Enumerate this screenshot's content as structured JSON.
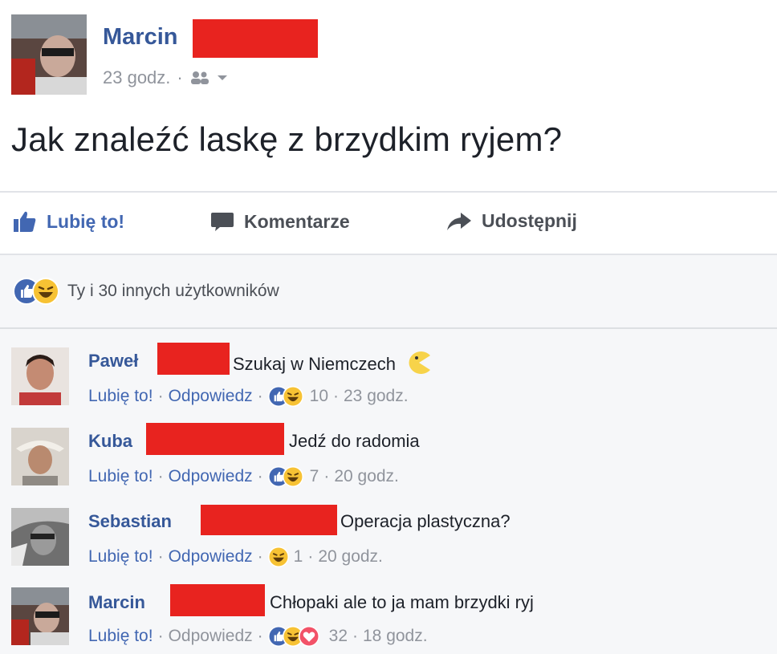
{
  "post": {
    "author": "Marcin",
    "time": "23 godz.",
    "text": "Jak znaleźć laskę z brzydkim ryjem?"
  },
  "actions": {
    "like": "Lubię to!",
    "comment": "Komentarze",
    "share": "Udostępnij"
  },
  "reactions_summary": "Ty i 30 innych użytkowników",
  "comments": [
    {
      "author": "Paweł",
      "text": "Szukaj w Niemczech",
      "like": "Lubię to!",
      "reply": "Odpowiedz",
      "reactions": "10",
      "time": "23 godz."
    },
    {
      "author": "Kuba",
      "text": "Jedź do radomia",
      "like": "Lubię to!",
      "reply": "Odpowiedz",
      "reactions": "7",
      "time": "20 godz."
    },
    {
      "author": "Sebastian",
      "text": "Operacja plastyczna?",
      "like": "Lubię to!",
      "reply": "Odpowiedz",
      "reactions": "1",
      "time": "20 godz."
    },
    {
      "author": "Marcin",
      "text": "Chłopaki ale to ja mam brzydki ryj",
      "like": "Lubię to!",
      "reply": "Odpowiedz",
      "reactions": "32",
      "time": "18 godz."
    }
  ],
  "colors": {
    "link": "#365899",
    "like_blue": "#4267b2",
    "redact": "#e8231f",
    "gray_text": "#90949c"
  }
}
